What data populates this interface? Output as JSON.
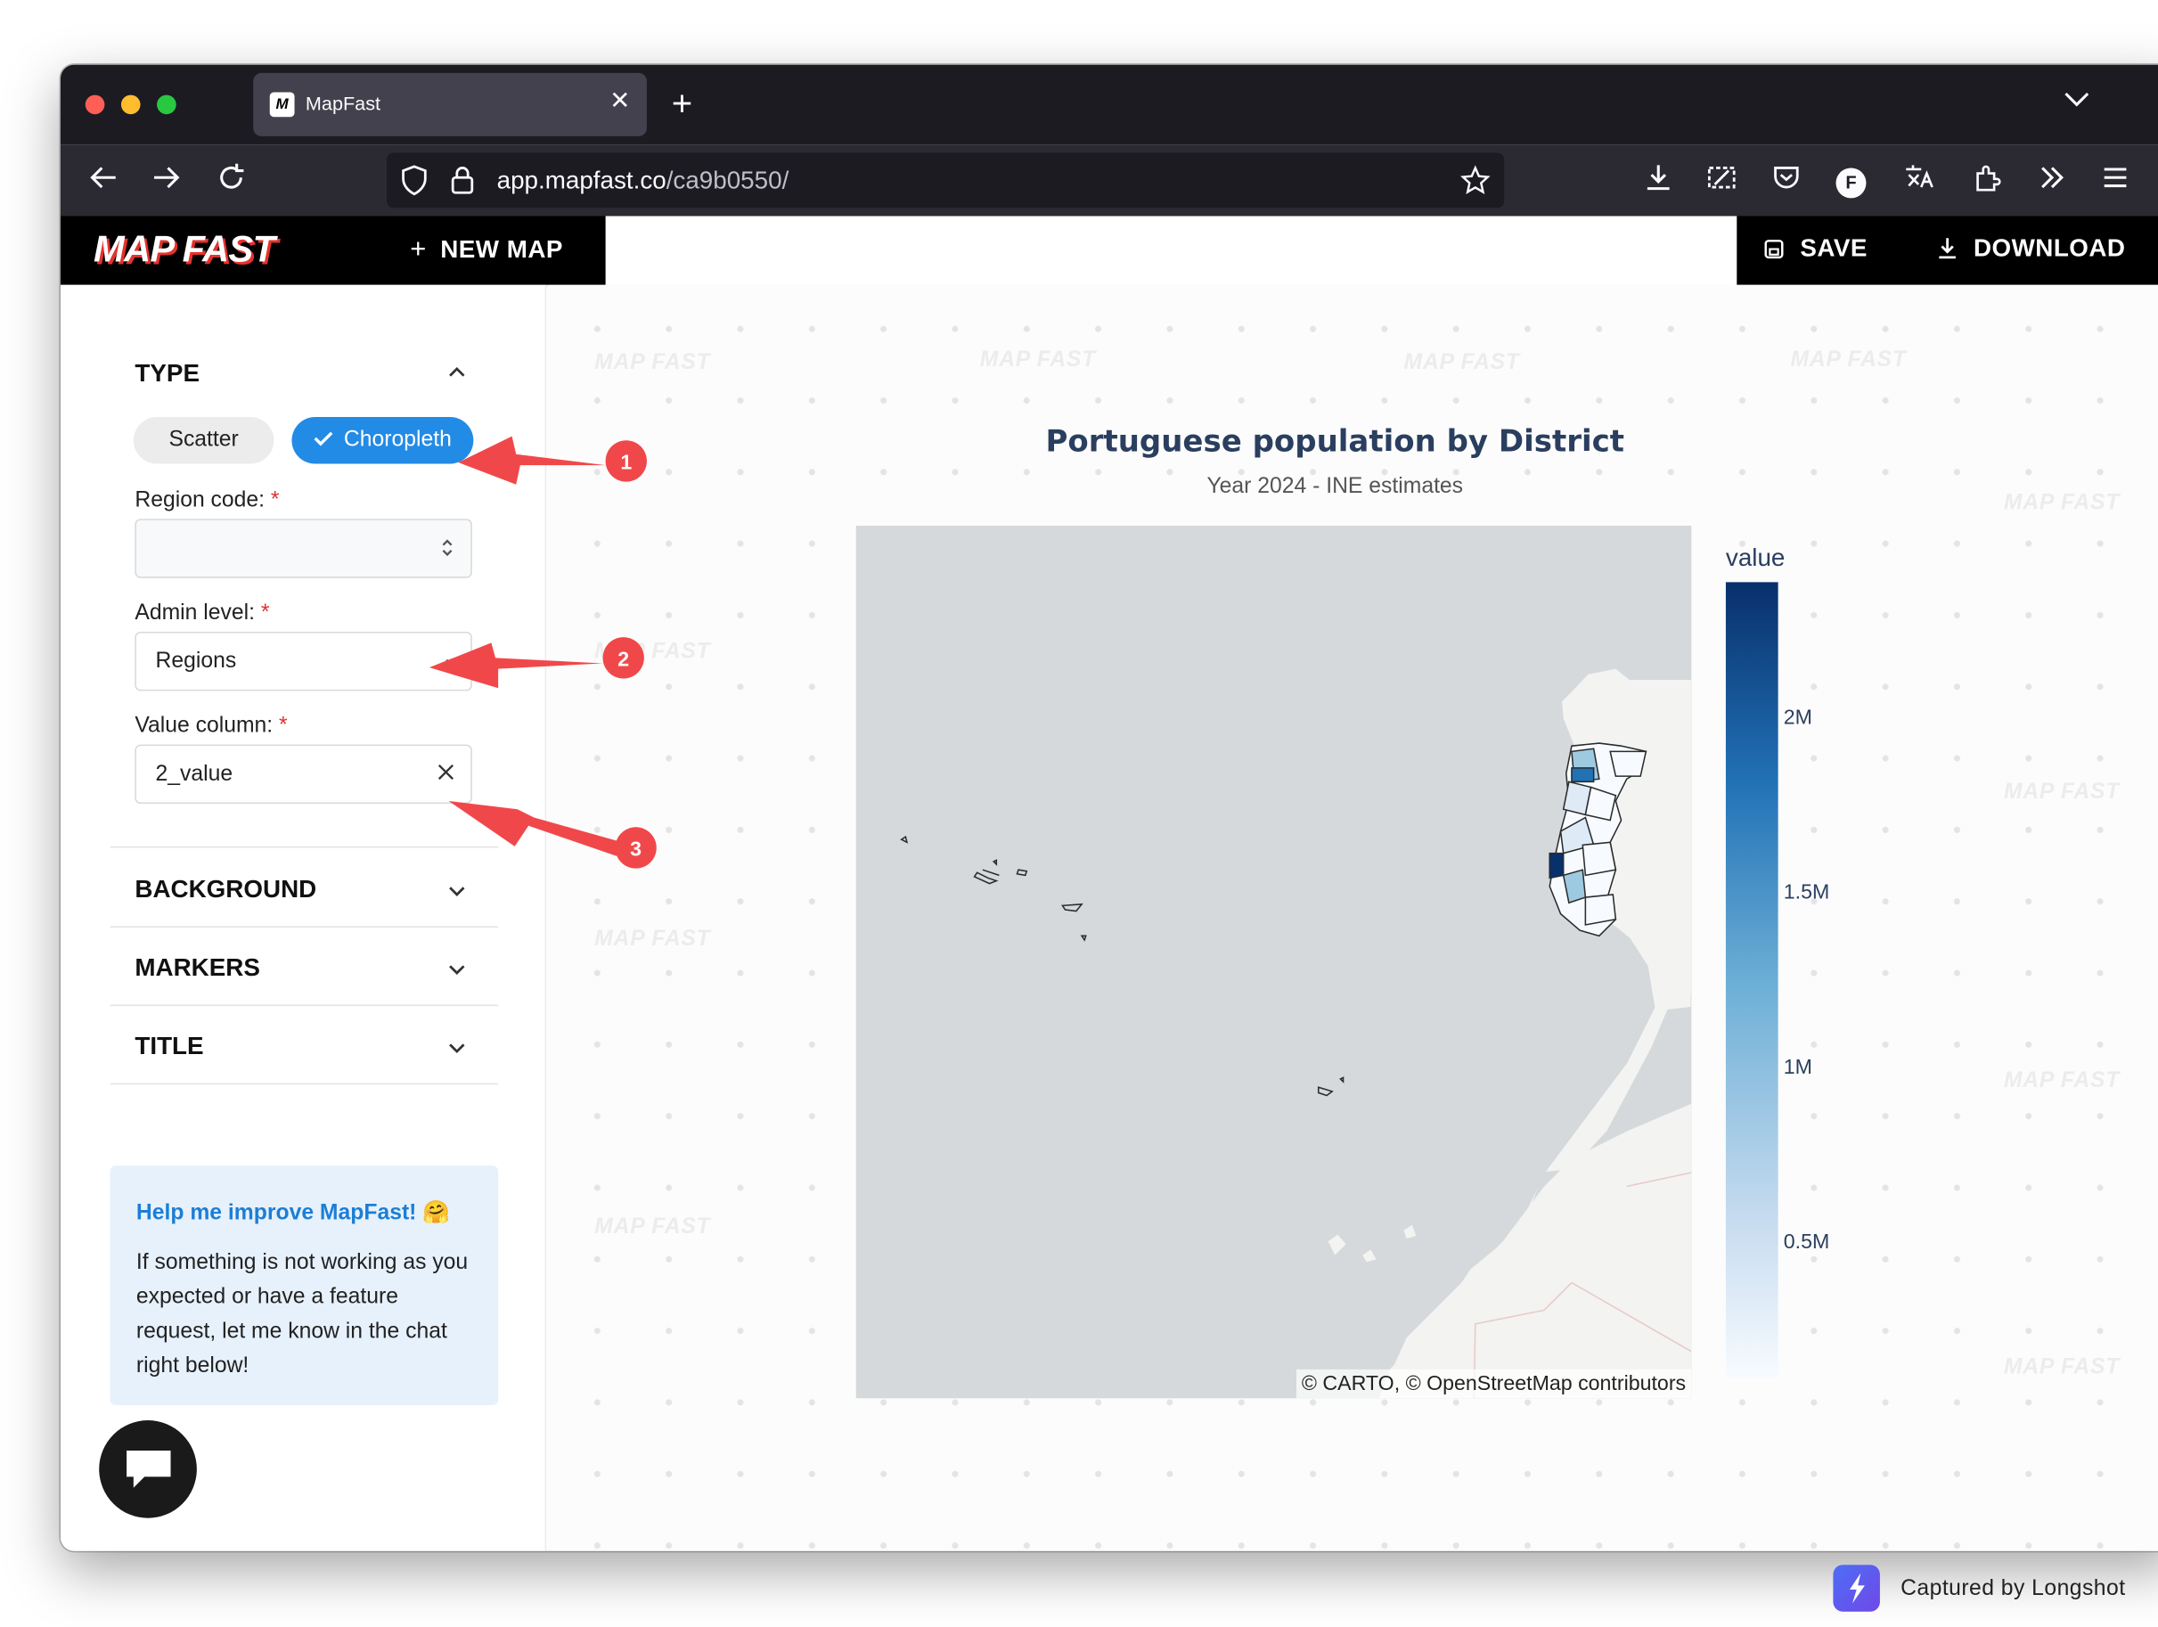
{
  "browser": {
    "tab_title": "MapFast",
    "url_host": "app.mapfast.co",
    "url_path": "/ca9b0550/",
    "profile_initial": "F"
  },
  "app": {
    "brand": "MAP FAST",
    "new_map_label": "NEW MAP",
    "save_label": "SAVE",
    "download_label": "DOWNLOAD",
    "watermark": "MAP FAST"
  },
  "sidebar": {
    "type_section": "TYPE",
    "type_options": [
      "Scatter",
      "Choropleth"
    ],
    "type_selected": "Choropleth",
    "region_code": {
      "label": "Region code:",
      "value": ""
    },
    "admin_level": {
      "label": "Admin level:",
      "value": "Regions"
    },
    "value_column": {
      "label": "Value column:",
      "value": "2_value"
    },
    "required_mark": "*",
    "sections": [
      "BACKGROUND",
      "MARKERS",
      "TITLE"
    ],
    "help": {
      "title": "Help me improve MapFast! 🤗",
      "body": "If something is not working as you expected or have a feature request, let me know in the chat right below!"
    }
  },
  "map": {
    "title": "Portuguese population by District",
    "subtitle": "Year 2024 - INE estimates",
    "attribution": "© CARTO, © OpenStreetMap contributors",
    "colorbar": {
      "title": "value",
      "ticks": [
        "2M",
        "1.5M",
        "1M",
        "0.5M"
      ],
      "scale_colors": [
        "#f7fbff",
        "#c6dbef",
        "#6baed6",
        "#2171b5",
        "#08306b"
      ]
    },
    "land_color": "#f3f3f1",
    "sea_color": "#d5d9db"
  },
  "annotations": [
    "1",
    "2",
    "3"
  ],
  "annotation_color": "#f0484a",
  "capture": {
    "label": "Captured by Longshot"
  }
}
